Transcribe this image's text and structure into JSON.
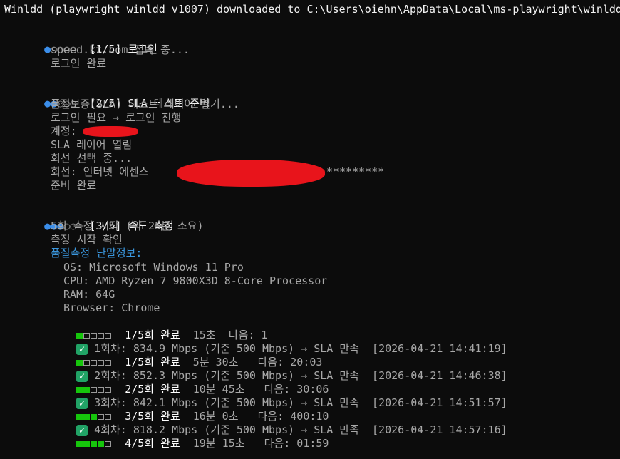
{
  "header_line": "Winldd (playwright winldd v1007) downloaded to C:\\Users\\oiehn\\AppData\\Local\\ms-playwright\\winldd",
  "steps": [
    {
      "dots_on": 1,
      "dots_total": 5,
      "title": "[1/5] 로그인",
      "lines": [
        "speed.kt.com 접속 중...",
        "로그인 완료"
      ]
    },
    {
      "dots_on": 2,
      "dots_total": 5,
      "title": "[2/5] SLA 테스트 준비",
      "lines": [
        "품질보증(SLA) 테스트 레이어 열기...",
        "로그인 필요 → 로그인 진행",
        "계정:",
        "SLA 레이어 열림",
        "회선 선택 중...",
        "회선: 인터넷 에센스",
        "준비 완료"
      ],
      "masked_suffix": "*********"
    },
    {
      "dots_on": 3,
      "dots_total": 5,
      "title": "[3/5] 속도 측정",
      "lines": [
        "5회 측정 시작 (약 25분 소요)",
        "측정 시작 확인"
      ],
      "info_label": "품질측정 단말정보:",
      "info": [
        "OS: Microsoft Windows 11 Pro",
        "CPU: AMD Ryzen 7 9800X3D 8-Core Processor",
        "RAM: 64G",
        "Browser: Chrome"
      ]
    }
  ],
  "progress_rows": [
    {
      "filled": 1,
      "label": "1/5회 완료",
      "elapsed": "15초",
      "next": "다음: 1"
    },
    {
      "filled": 1,
      "label": "1/5회 완료",
      "elapsed": "5분 30초",
      "next": "다음: 20:03"
    },
    {
      "filled": 2,
      "label": "2/5회 완료",
      "elapsed": "10분 45초",
      "next": "다음: 30:06"
    },
    {
      "filled": 3,
      "label": "3/5회 완료",
      "elapsed": "16분 0초",
      "next": "다음: 400:10"
    },
    {
      "filled": 4,
      "label": "4/5회 완료",
      "elapsed": "19분 15초",
      "next": "다음: 01:59"
    }
  ],
  "results": [
    {
      "round": "1회차:",
      "speed": "834.9 Mbps",
      "baseline": "(기준 500 Mbps)",
      "verdict": "→ SLA 만족",
      "time": "[2026-04-21 14:41:19]"
    },
    {
      "round": "2회차:",
      "speed": "852.3 Mbps",
      "baseline": "(기준 500 Mbps)",
      "verdict": "→ SLA 만족",
      "time": "[2026-04-21 14:46:38]"
    },
    {
      "round": "3회차:",
      "speed": "842.1 Mbps",
      "baseline": "(기준 500 Mbps)",
      "verdict": "→ SLA 만족",
      "time": "[2026-04-21 14:51:57]"
    },
    {
      "round": "4회차:",
      "speed": "818.2 Mbps",
      "baseline": "(기준 500 Mbps)",
      "verdict": "→ SLA 만족",
      "time": "[2026-04-21 14:57:16]"
    }
  ],
  "bar_total": 5,
  "colors": {
    "background": "#0c0c0c",
    "dot_active": "#3b8eea",
    "bar_fill": "#16c60c",
    "check": "#21a366",
    "redaction": "#e8141b",
    "info_label": "#3a96dd"
  }
}
